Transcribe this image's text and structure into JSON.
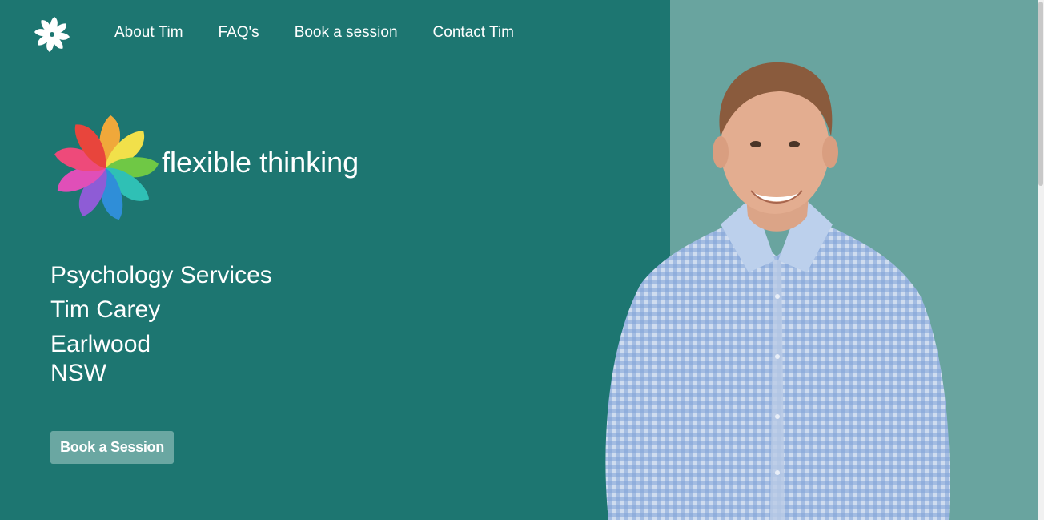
{
  "nav": {
    "items": [
      {
        "label": "About Tim"
      },
      {
        "label": "FAQ's"
      },
      {
        "label": "Book a session"
      },
      {
        "label": "Contact Tim"
      }
    ]
  },
  "hero": {
    "brand_name": "flexible thinking",
    "lines": [
      "Psychology Services",
      "Tim Carey",
      "Earlwood",
      "NSW"
    ],
    "cta_label": "Book a Session"
  },
  "colors": {
    "primary_bg": "#1d7671",
    "secondary_bg": "#69a49f",
    "button_bg": "#6aa7a2",
    "text": "#ffffff"
  },
  "icons": {
    "nav_logo": "pinwheel-icon",
    "brand_logo": "rainbow-pinwheel-icon"
  }
}
